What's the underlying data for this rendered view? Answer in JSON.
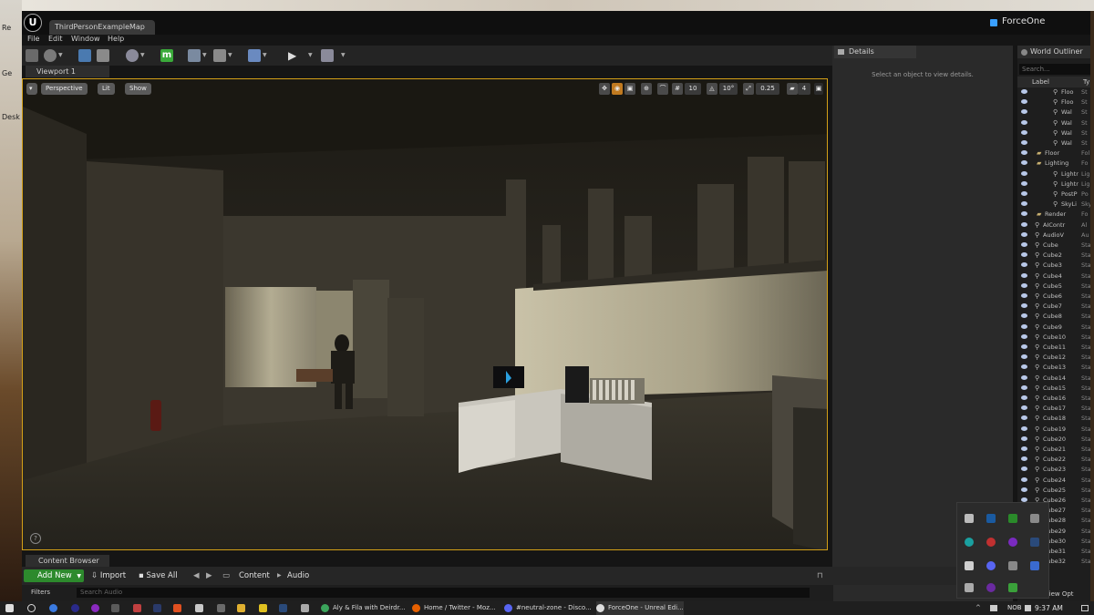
{
  "desktop": {
    "icons": [
      "Re",
      "Ge",
      "Desk"
    ]
  },
  "window": {
    "map_tab": "ThirdPersonExampleMap",
    "project": "ForceOne"
  },
  "menu": [
    "File",
    "Edit",
    "Window",
    "Help"
  ],
  "viewport": {
    "tab": "Viewport 1",
    "perspective": "Perspective",
    "lit": "Lit",
    "show": "Show",
    "grid_snap": "10",
    "rotation_snap": "10°",
    "scale_snap": "0.25",
    "camera_speed": "4"
  },
  "details": {
    "tab": "Details",
    "empty_message": "Select an object to view details."
  },
  "outliner": {
    "tab": "World Outliner",
    "search_placeholder": "Search...",
    "col_label": "Label",
    "col_type": "Ty",
    "rows": [
      {
        "label": "Floo",
        "type": "St"
      },
      {
        "label": "Floo",
        "type": "St"
      },
      {
        "label": "Wal",
        "type": "St"
      },
      {
        "label": "Wal",
        "type": "St"
      },
      {
        "label": "Wal",
        "type": "St"
      },
      {
        "label": "Wal",
        "type": "St"
      },
      {
        "label": "Floor",
        "type": "Fol"
      },
      {
        "label": "Lighting",
        "type": "Fo"
      },
      {
        "label": "Lightr",
        "type": "Lig"
      },
      {
        "label": "Lightr",
        "type": "Lig"
      },
      {
        "label": "PostP",
        "type": "Po"
      },
      {
        "label": "SkyLi",
        "type": "Sky"
      },
      {
        "label": "Render",
        "type": "Fo"
      },
      {
        "label": "AIContr",
        "type": "Al"
      },
      {
        "label": "AudioV",
        "type": "Au"
      },
      {
        "label": "Cube",
        "type": "Sta"
      },
      {
        "label": "Cube2",
        "type": "Sta"
      },
      {
        "label": "Cube3",
        "type": "Sta"
      },
      {
        "label": "Cube4",
        "type": "Sta"
      },
      {
        "label": "Cube5",
        "type": "Sta"
      },
      {
        "label": "Cube6",
        "type": "Sta"
      },
      {
        "label": "Cube7",
        "type": "Sta"
      },
      {
        "label": "Cube8",
        "type": "Sta"
      },
      {
        "label": "Cube9",
        "type": "Sta"
      },
      {
        "label": "Cube10",
        "type": "Sta"
      },
      {
        "label": "Cube11",
        "type": "Sta"
      },
      {
        "label": "Cube12",
        "type": "Sta"
      },
      {
        "label": "Cube13",
        "type": "Sta"
      },
      {
        "label": "Cube14",
        "type": "Sta"
      },
      {
        "label": "Cube15",
        "type": "Sta"
      },
      {
        "label": "Cube16",
        "type": "Sta"
      },
      {
        "label": "Cube17",
        "type": "Sta"
      },
      {
        "label": "Cube18",
        "type": "Sta"
      },
      {
        "label": "Cube19",
        "type": "Sta"
      },
      {
        "label": "Cube20",
        "type": "Sta"
      },
      {
        "label": "Cube21",
        "type": "Sta"
      },
      {
        "label": "Cube22",
        "type": "Sta"
      },
      {
        "label": "Cube23",
        "type": "Sta"
      },
      {
        "label": "Cube24",
        "type": "Sta"
      },
      {
        "label": "Cube25",
        "type": "Sta"
      },
      {
        "label": "Cube26",
        "type": "Sta"
      },
      {
        "label": "Cube27",
        "type": "Sta"
      },
      {
        "label": "Cube28",
        "type": "Sta"
      },
      {
        "label": "Cube29",
        "type": "Sta"
      },
      {
        "label": "Cube30",
        "type": "Sta"
      },
      {
        "label": "Cube31",
        "type": "Sta"
      },
      {
        "label": "Cube32",
        "type": "Sta"
      }
    ],
    "view_options": "View Opt"
  },
  "content_browser": {
    "tab": "Content Browser",
    "add_new": "Add New",
    "import": "Import",
    "save_all": "Save All",
    "path": [
      "Content",
      "Audio"
    ],
    "filters": "Filters",
    "search_placeholder": "Search Audio"
  },
  "taskbar": {
    "apps": [
      {
        "label": "Aly & Fila with Deirdr...",
        "color": "#3ba55c"
      },
      {
        "label": "Home / Twitter - Moz...",
        "color": "#e66000"
      },
      {
        "label": "#neutral-zone - Disco...",
        "color": "#5865f2"
      },
      {
        "label": "ForceOne - Unreal Edi...",
        "color": "#dddddd"
      }
    ],
    "lang": "NOB",
    "clock": "9:37 AM"
  },
  "colors": {
    "accent_border": "#d4a017",
    "add_new_green": "#2d8a2d"
  }
}
